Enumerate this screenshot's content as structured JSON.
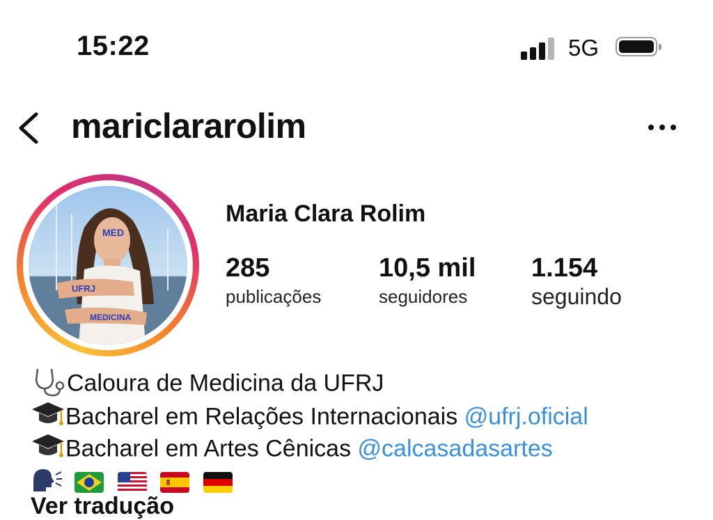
{
  "status": {
    "time": "15:22",
    "network": "5G"
  },
  "header": {
    "username": "mariclararolim"
  },
  "profile": {
    "display_name": "Maria Clara Rolim",
    "stats": {
      "posts": {
        "value": "285",
        "label": "publicações"
      },
      "followers": {
        "value": "10,5 mil",
        "label": "seguidores"
      },
      "following": {
        "value": "1.154",
        "label": "seguindo"
      }
    },
    "photo_text": {
      "forehead": "MED",
      "arm_top": "UFRJ",
      "arm_bottom": "MEDICINA"
    }
  },
  "bio": {
    "line1": {
      "icon": "stethoscope",
      "text": "Caloura de Medicina da UFRJ"
    },
    "line2": {
      "icon": "graduation-cap",
      "text": "Bacharel em Relações Internacionais ",
      "mention": "@ufrj.oficial"
    },
    "line3": {
      "icon": "graduation-cap",
      "text": "Bacharel em Artes Cênicas ",
      "mention": "@calcasadasartes"
    },
    "line4": {
      "icon": "speaking-head",
      "flags": [
        "brazil",
        "usa",
        "spain",
        "germany"
      ]
    }
  },
  "translation_label": "Ver tradução",
  "colors": {
    "link": "#3a8fd8",
    "ring_start": "#f9c33b",
    "ring_end": "#c13584"
  }
}
